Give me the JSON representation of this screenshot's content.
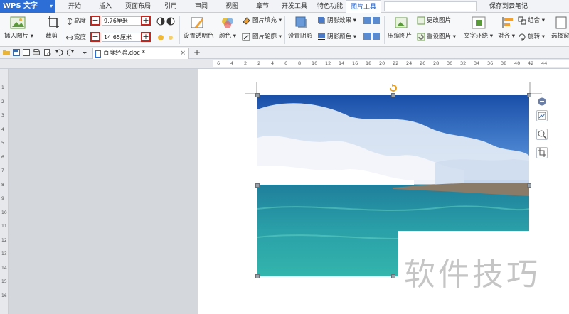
{
  "app": {
    "logo": "WPS 文字",
    "logo_arrow": "▾"
  },
  "menu": {
    "tabs": [
      "开始",
      "插入",
      "页面布局",
      "引用",
      "审阅",
      "视图",
      "章节",
      "开发工具",
      "特色功能",
      "图片工具"
    ],
    "active_tab": "图片工具",
    "cloud_label": "保存到云笔记"
  },
  "ribbon": {
    "insert_picture": "插入图片",
    "crop": "裁剪",
    "height_label": "高度:",
    "height_value": "9.76厘米",
    "width_label": "宽度:",
    "width_value": "14.65厘米",
    "minus": "−",
    "plus": "+",
    "set_transparent": "设置透明色",
    "color": "颜色",
    "picture_fill": "图片填充",
    "picture_outline": "图片轮廓",
    "set_shadow": "设置阴影",
    "shadow_effect": "阴影效果",
    "shadow_color": "阴影颜色",
    "compress_picture": "压缩图片",
    "change_picture": "更改图片",
    "reset_picture": "重设图片",
    "text_wrap": "文字环绕",
    "align": "对齐",
    "group": "组合",
    "rotate": "旋转",
    "select_pane": "选择窗"
  },
  "document": {
    "tab_name": "百度经验.doc *",
    "tab_close": "×",
    "new_tab": "+"
  },
  "ruler": {
    "h_numbers": [
      "6",
      "4",
      "2",
      "2",
      "4",
      "6",
      "8",
      "10",
      "12",
      "14",
      "16",
      "18",
      "20",
      "22",
      "24",
      "26",
      "28",
      "30",
      "32",
      "34",
      "36",
      "38",
      "40",
      "42",
      "44"
    ],
    "v_numbers": [
      "1",
      "2",
      "3",
      "4",
      "5",
      "6",
      "7",
      "8",
      "9",
      "10",
      "11",
      "12",
      "13",
      "14",
      "15",
      "16"
    ]
  },
  "watermark": {
    "text": "软件技巧"
  },
  "colors": {
    "logo_bg": "#2c6ed5",
    "highlight_box": "#c1271f",
    "active_tab": "#1a56b8"
  }
}
